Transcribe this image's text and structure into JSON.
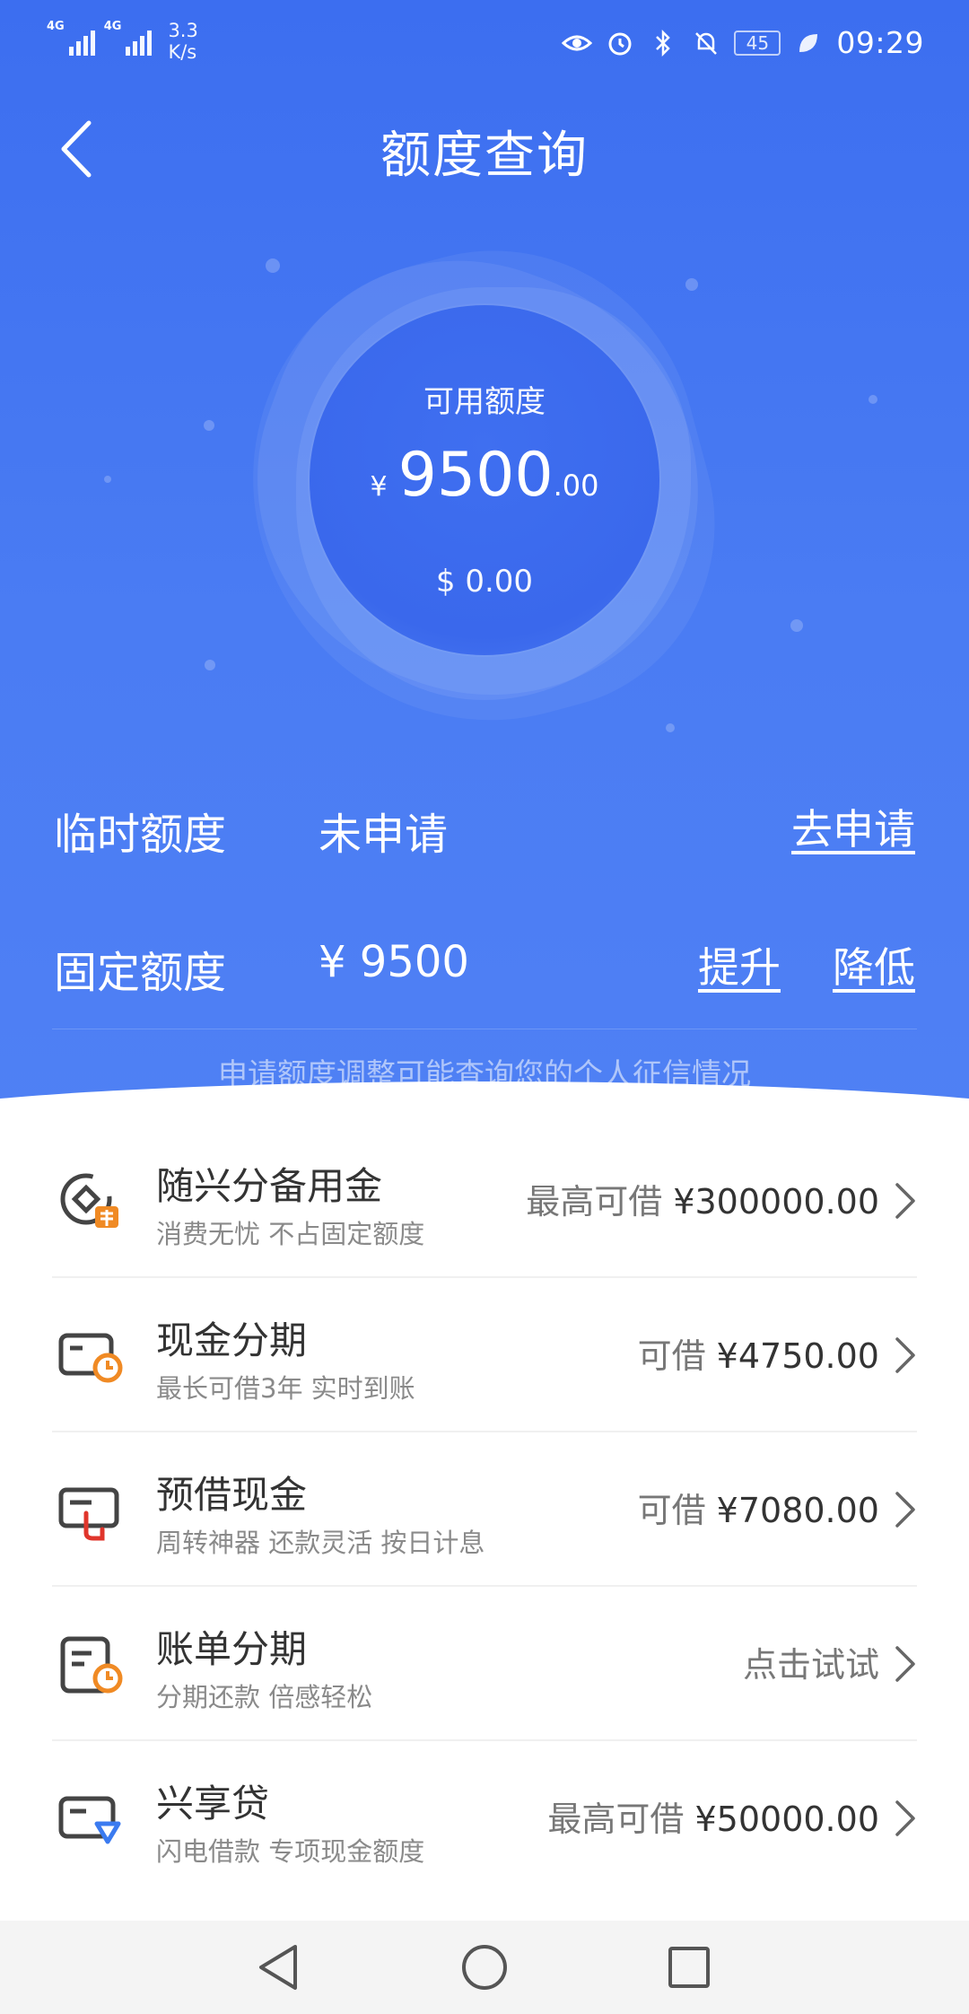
{
  "status_bar": {
    "network1": "4G",
    "network2": "4G",
    "speed_value": "3.3",
    "speed_unit": "K/s",
    "battery": "45",
    "time": "09:29"
  },
  "nav": {
    "title": "额度查询"
  },
  "available": {
    "label": "可用额度",
    "currency": "¥",
    "amount_integer": "9500",
    "amount_decimal": ".00",
    "usd": "$ 0.00"
  },
  "temp_quota": {
    "label": "临时额度",
    "value": "未申请",
    "apply_link": "去申请"
  },
  "fixed_quota": {
    "label": "固定额度",
    "value": "¥ 9500",
    "raise_link": "提升",
    "lower_link": "降低"
  },
  "notice": "申请额度调整可能查询您的个人征信情况",
  "colors": {
    "primary_blue": "#3c6ef0",
    "icon_orange": "#f08a24",
    "icon_red": "#e0352b",
    "icon_blue": "#3b7bf0"
  },
  "items": [
    {
      "icon": "reserve-fund-icon",
      "title": "随兴分备用金",
      "subtitle": "消费无忧 不占固定额度",
      "prefix": "最高可借",
      "amount": "¥300000.00"
    },
    {
      "icon": "cash-installment-icon",
      "title": "现金分期",
      "subtitle": "最长可借3年 实时到账",
      "prefix": "可借",
      "amount": "¥4750.00"
    },
    {
      "icon": "prepaid-cash-icon",
      "title": "预借现金",
      "subtitle": "周转神器 还款灵活 按日计息",
      "prefix": "可借",
      "amount": "¥7080.00"
    },
    {
      "icon": "bill-installment-icon",
      "title": "账单分期",
      "subtitle": "分期还款 倍感轻松",
      "action": "点击试试"
    },
    {
      "icon": "xingxiang-loan-icon",
      "title": "兴享贷",
      "subtitle": "闪电借款 专项现金额度",
      "prefix": "最高可借",
      "amount": "¥50000.00"
    }
  ]
}
